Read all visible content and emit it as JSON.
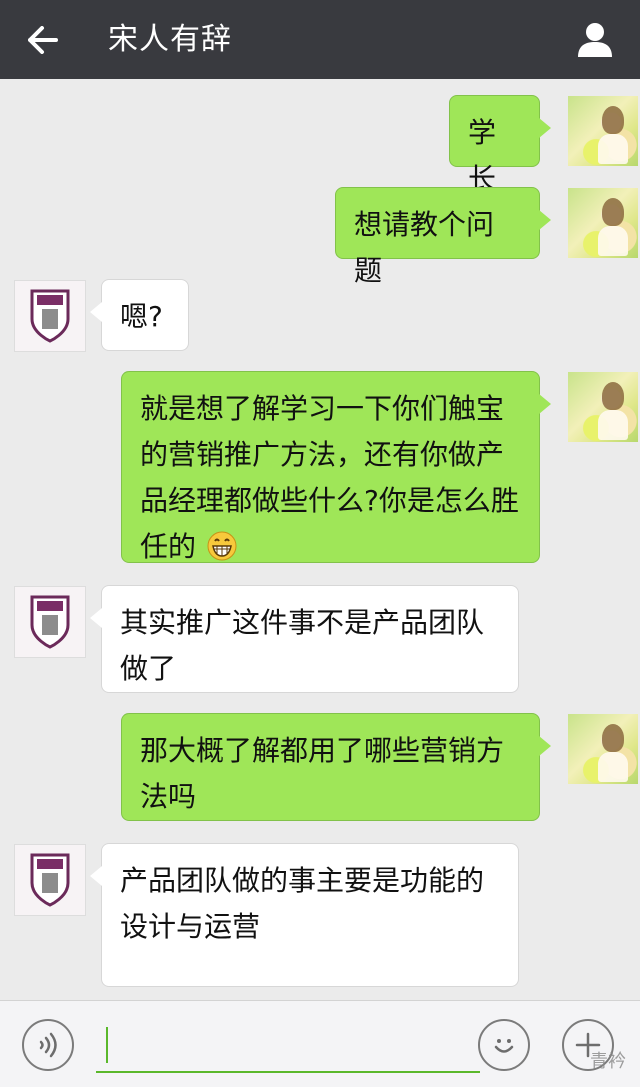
{
  "header": {
    "title": "宋人有辞",
    "back_icon": "arrow-left-icon",
    "profile_icon": "person-icon"
  },
  "messages": [
    {
      "sender": "me",
      "text": "学长"
    },
    {
      "sender": "me",
      "text": "想请教个问题"
    },
    {
      "sender": "other",
      "text": "嗯?"
    },
    {
      "sender": "me",
      "line1": "就是想了解学习一下你们触宝",
      "line2": "的营销推广方法，还有你做产",
      "line3": "品经理都做些什么?你是怎么胜",
      "line4": "任的",
      "emoji": "grinning-face-icon"
    },
    {
      "sender": "other",
      "line1": "其实推广这件事不是产品团队",
      "line2": "做了"
    },
    {
      "sender": "me",
      "line1": "那大概了解都用了哪些营销方",
      "line2": "法吗"
    },
    {
      "sender": "other",
      "line1": "产品团队做的事主要是功能的",
      "line2": "设计与运营"
    }
  ],
  "input": {
    "voice_icon": "voice-icon",
    "emoji_icon": "smiley-icon",
    "plus_icon": "plus-icon",
    "value": ""
  },
  "watermark": "青衿"
}
